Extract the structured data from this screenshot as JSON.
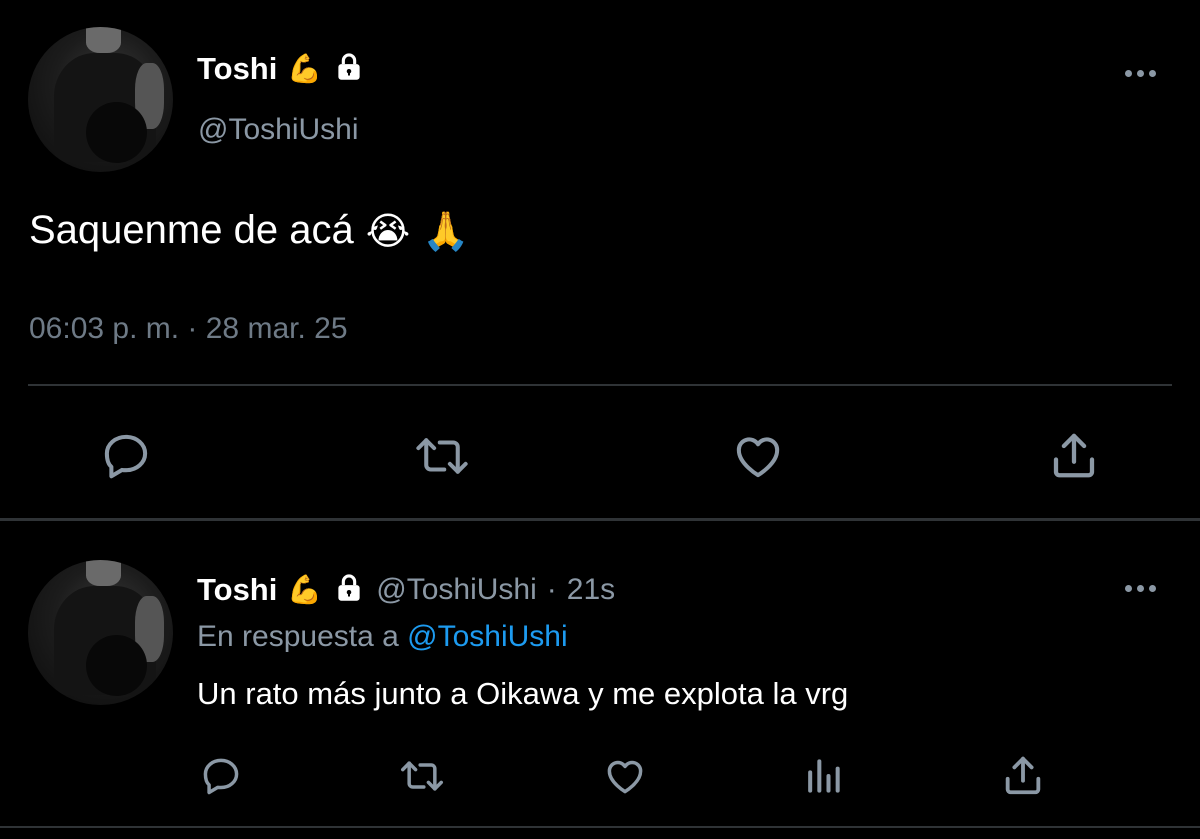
{
  "main_tweet": {
    "author": {
      "display_name": "Toshi",
      "name_emoji": "💪",
      "handle": "@ToshiUshi",
      "protected_icon": "lock-icon"
    },
    "text": "Saquenme de acá",
    "text_emojis": [
      "😭",
      "🙏"
    ],
    "timestamp": "06:03 p. m. · 28 mar. 25",
    "actions": [
      "reply-icon",
      "retweet-icon",
      "like-icon",
      "share-icon"
    ],
    "more_icon": "more-icon"
  },
  "reply_tweet": {
    "author": {
      "display_name": "Toshi",
      "name_emoji": "💪",
      "handle": "@ToshiUshi",
      "protected_icon": "lock-icon"
    },
    "separator": "·",
    "time_ago": "21s",
    "reply_to_prefix": "En respuesta a",
    "reply_to_handle": "@ToshiUshi",
    "text": "Un rato más junto a Oikawa y me explota la vrg",
    "actions": [
      "reply-icon",
      "retweet-icon",
      "like-icon",
      "analytics-icon",
      "share-icon"
    ],
    "more_icon": "more-icon"
  },
  "colors": {
    "background": "#000000",
    "text_primary": "#ffffff",
    "text_secondary": "#8b98a5",
    "link": "#1d9bf0",
    "divider": "#2f3336"
  }
}
